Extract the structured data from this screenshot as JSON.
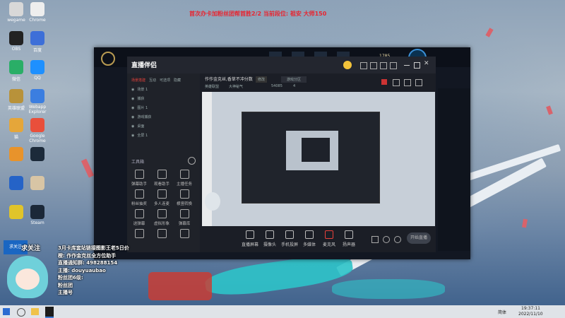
{
  "banner": "首次办卡加粉丝团帮首胜2/2  当前段位: 祖安 大师150",
  "desktop_icons": [
    {
      "label": "wegame",
      "color": "#d8d8d8"
    },
    {
      "label": "Chrome",
      "color": "#eeeeee"
    },
    {
      "label": "OBS",
      "color": "#222222"
    },
    {
      "label": "百度",
      "color": "#3d6fd8"
    },
    {
      "label": "微信",
      "color": "#2aae67"
    },
    {
      "label": "QQ",
      "color": "#1e90ff"
    },
    {
      "label": "英雄联盟",
      "color": "#b8923a"
    },
    {
      "label": "Webapp Explorer",
      "color": "#3b7ee0"
    },
    {
      "label": "猫",
      "color": "#e5a63a"
    },
    {
      "label": "Google Chrome",
      "color": "#e94f3b"
    },
    {
      "label": "",
      "color": "#e8932b"
    },
    {
      "label": "",
      "color": "#1c2a3a"
    },
    {
      "label": "",
      "color": "#2563c7"
    },
    {
      "label": "",
      "color": "#d8c5a5"
    },
    {
      "label": "",
      "color": "#e0c42a"
    },
    {
      "label": "Steam",
      "color": "#1b2838"
    }
  ],
  "lol_client": {
    "currency": "1785",
    "rp": "0"
  },
  "app": {
    "logo": "直播伴侣",
    "title_field": "作作金克丝,香草不冲分数",
    "title_action": "修改",
    "category": "游戏分区",
    "sub_left": "英雄联盟",
    "sub_mid": "大神秘气",
    "sub_right": "54085",
    "sub_count": "4",
    "scene_tabs": [
      "场景搭建",
      "互动",
      "可选项",
      "隐藏"
    ],
    "scenes": [
      {
        "label": "场景 1"
      },
      {
        "label": "捕获"
      },
      {
        "label": "图片 1"
      },
      {
        "label": "游戏捕获"
      },
      {
        "label": "桌面"
      },
      {
        "label": "全屏 1"
      }
    ],
    "tools_label": "工具箱",
    "tools": [
      "弹幕助手",
      "观看助手",
      "主播任务",
      "粉丝抽奖",
      "多人连麦",
      "横竖转换",
      "送弹幕",
      "虚拟形象",
      "弹幕库",
      "",
      "",
      ""
    ],
    "bottom_buttons": [
      "直播屏幕",
      "摄像头",
      "手机投屏",
      "多媒体",
      "麦克风",
      "扬声器"
    ],
    "start_button": "开始直播"
  },
  "overlay": {
    "follow": "求关注",
    "lines": [
      "3月卡库套站链接图影王老5日价",
      "橙: 作作金克丝全方位助手",
      "直播通知群: 498288154",
      "主播: douyuaubao",
      "粉丝团6级:",
      "粉丝团",
      "主播号"
    ]
  },
  "taskbar": {
    "time": "19:37:11",
    "date": "2022/11/10",
    "lang": "简体"
  }
}
